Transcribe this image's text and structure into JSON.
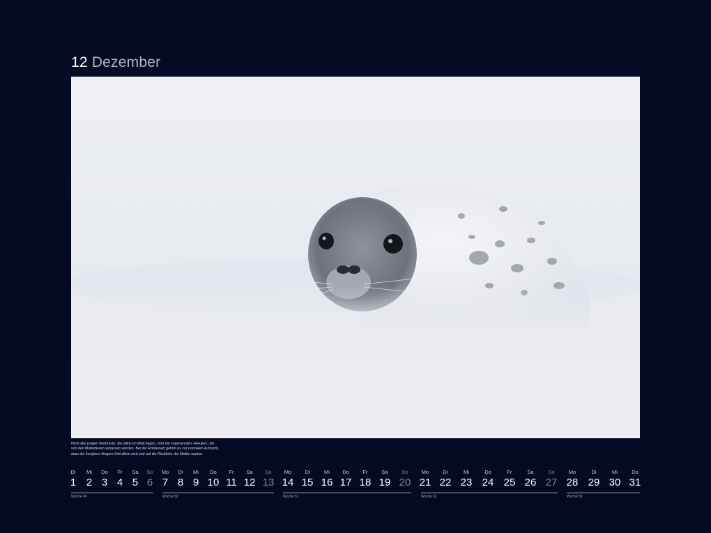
{
  "header": {
    "month_number": "12",
    "month_name": "Dezember"
  },
  "caption": {
    "lines": [
      "Nicht alle jungen Seehunde, die allein im Watt liegen, sind die sogenannten »Heuler«, die",
      "von den Muttertieren verlassen wurden. Bei der Robbenart gehört es zur normalen Aufzucht,",
      "dass die Jungtiere längere Zeit allein sind und auf die Rückkehr der Mutter warten."
    ]
  },
  "weeks": [
    {
      "label": "Woche 49",
      "days": [
        {
          "dn": "Di",
          "d": "1"
        },
        {
          "dn": "Mi",
          "d": "2"
        },
        {
          "dn": "Do",
          "d": "3"
        },
        {
          "dn": "Fr",
          "d": "4"
        },
        {
          "dn": "Sa",
          "d": "5"
        },
        {
          "dn": "So",
          "d": "6",
          "sunday": true
        }
      ]
    },
    {
      "label": "Woche 50",
      "days": [
        {
          "dn": "Mo",
          "d": "7"
        },
        {
          "dn": "Di",
          "d": "8"
        },
        {
          "dn": "Mi",
          "d": "9"
        },
        {
          "dn": "Do",
          "d": "10"
        },
        {
          "dn": "Fr",
          "d": "11"
        },
        {
          "dn": "Sa",
          "d": "12"
        },
        {
          "dn": "So",
          "d": "13",
          "sunday": true
        }
      ]
    },
    {
      "label": "Woche 51",
      "days": [
        {
          "dn": "Mo",
          "d": "14"
        },
        {
          "dn": "Di",
          "d": "15"
        },
        {
          "dn": "Mi",
          "d": "16"
        },
        {
          "dn": "Do",
          "d": "17"
        },
        {
          "dn": "Fr",
          "d": "18"
        },
        {
          "dn": "Sa",
          "d": "19"
        },
        {
          "dn": "So",
          "d": "20",
          "sunday": true
        }
      ]
    },
    {
      "label": "Woche 52",
      "days": [
        {
          "dn": "Mo",
          "d": "21"
        },
        {
          "dn": "Di",
          "d": "22"
        },
        {
          "dn": "Mi",
          "d": "23"
        },
        {
          "dn": "Do",
          "d": "24"
        },
        {
          "dn": "Fr",
          "d": "25"
        },
        {
          "dn": "Sa",
          "d": "26"
        },
        {
          "dn": "So",
          "d": "27",
          "sunday": true
        }
      ]
    },
    {
      "label": "Woche 53",
      "days": [
        {
          "dn": "Mo",
          "d": "28"
        },
        {
          "dn": "Di",
          "d": "29"
        },
        {
          "dn": "Mi",
          "d": "30"
        },
        {
          "dn": "Do",
          "d": "31"
        }
      ]
    }
  ],
  "colors": {
    "background": "#050a24",
    "sunday": "#80859c",
    "snow": "#eef0f4"
  }
}
